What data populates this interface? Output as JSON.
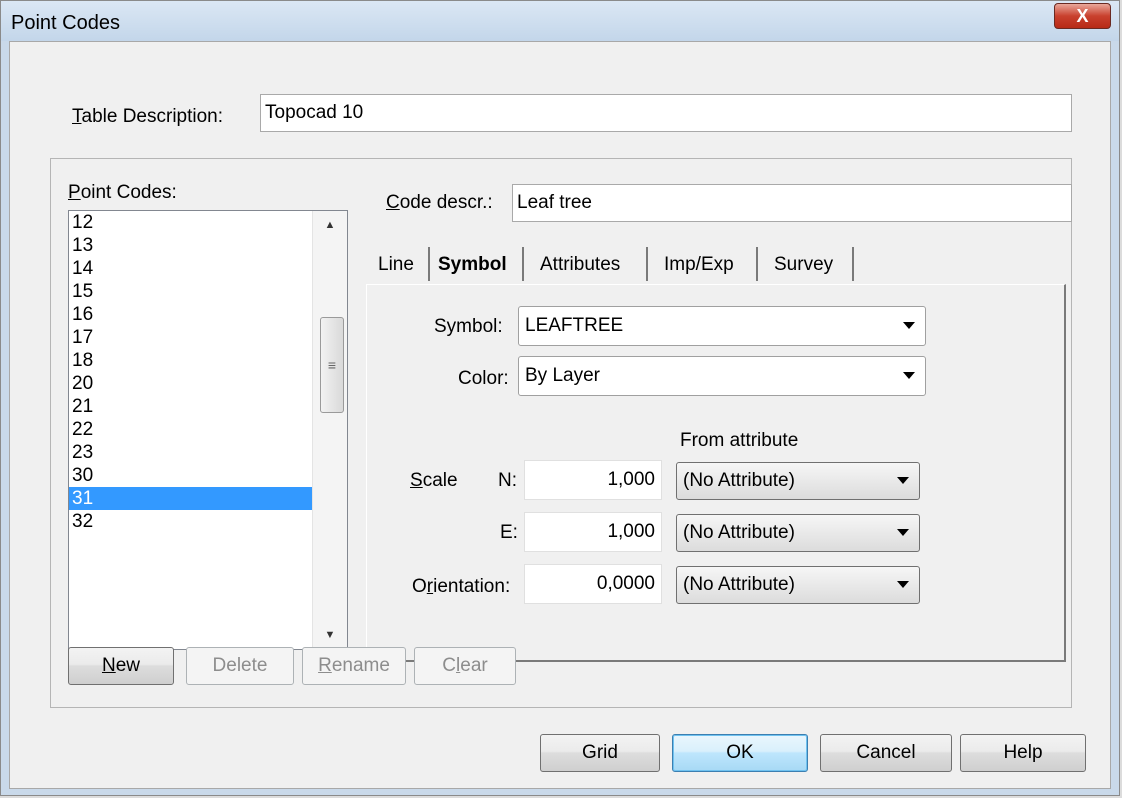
{
  "window": {
    "title": "Point Codes",
    "close_glyph": "X"
  },
  "table_description": {
    "label_u": "T",
    "label_rest": "able Description:",
    "value": "Topocad 10"
  },
  "point_codes": {
    "label_u": "P",
    "label_rest": "oint Codes:",
    "items": [
      "12",
      "13",
      "14",
      "15",
      "16",
      "17",
      "18",
      "20",
      "21",
      "22",
      "23",
      "30",
      "31",
      "32"
    ],
    "selected": "31",
    "scroll_up_icon": "▲",
    "scroll_down_icon": "▼",
    "scroll_grip": "≡"
  },
  "code_descr": {
    "label_u": "C",
    "label_rest": "ode descr.:",
    "value": "Leaf tree"
  },
  "tabs": [
    "Line",
    "Symbol",
    "Attributes",
    "Imp/Exp",
    "Survey"
  ],
  "active_tab": "Symbol",
  "symbol_tab": {
    "symbol_label": "Symbol:",
    "symbol_value": "LEAFTREE",
    "color_label": "Color:",
    "color_value": "By Layer",
    "from_attribute_label": "From attribute",
    "scale_label_u": "S",
    "scale_label_rest": "cale",
    "n_label": "N:",
    "n_value": "1,000",
    "n_attr": "(No Attribute)",
    "e_label": "E:",
    "e_value": "1,000",
    "e_attr": "(No Attribute)",
    "orientation_label_pre": "O",
    "orientation_label_u": "r",
    "orientation_label_rest": "ientation:",
    "orientation_value": "0,0000",
    "orientation_attr": "(No Attribute)"
  },
  "list_buttons": {
    "new_u": "N",
    "new_rest": "ew",
    "delete": "Delete",
    "rename_u": "R",
    "rename_rest": "ename",
    "clear_pre": "C",
    "clear_u": "l",
    "clear_rest": "ear"
  },
  "dialog_buttons": {
    "grid": "Grid",
    "ok": "OK",
    "cancel": "Cancel",
    "help": "Help"
  }
}
